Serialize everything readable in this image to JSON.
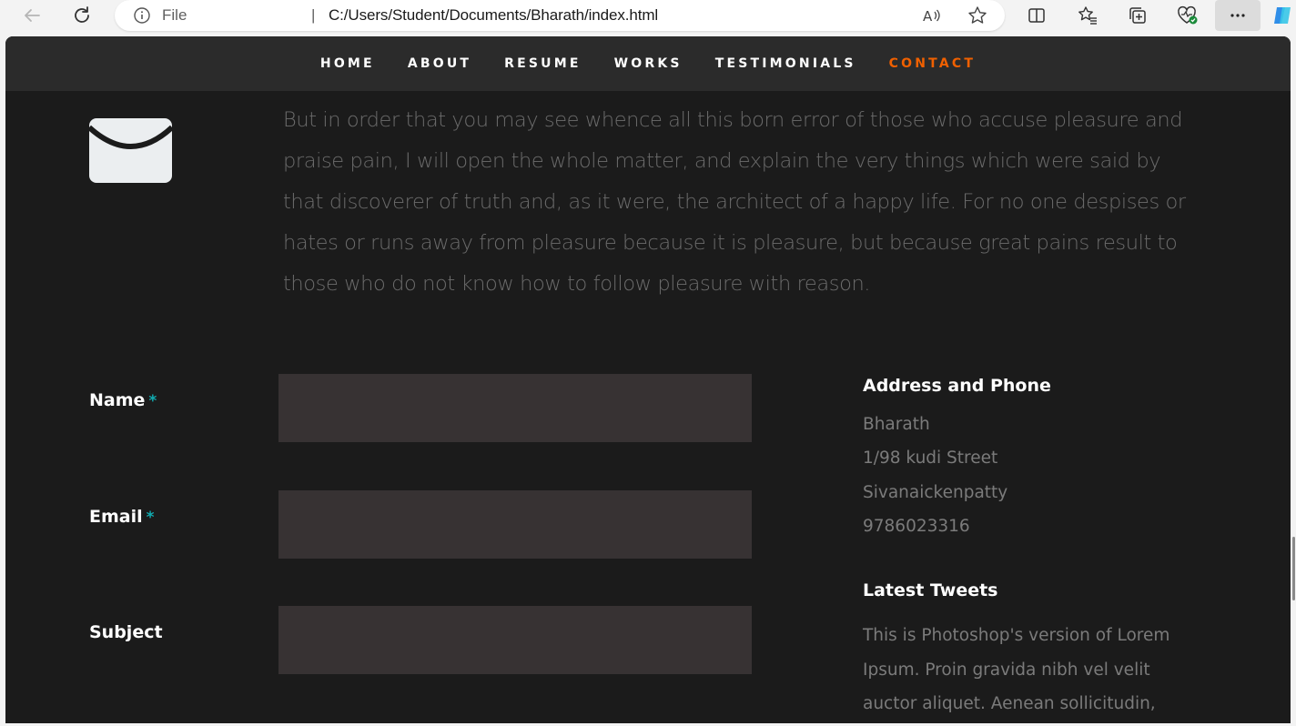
{
  "browser": {
    "file_label": "File",
    "separator": "|",
    "url": "C:/Users/Student/Documents/Bharath/index.html"
  },
  "nav": {
    "items": [
      "HOME",
      "ABOUT",
      "RESUME",
      "WORKS",
      "TESTIMONIALS",
      "CONTACT"
    ],
    "active": "CONTACT"
  },
  "intro": "But in order that you may see whence all this born error of those who accuse pleasure and praise pain, I will open the whole matter, and explain the very things which were said by that discoverer of truth and, as it were, the architect of a happy life. For no one despises or hates or runs away from pleasure because it is pleasure, but because great pains result to those who do not know how to follow pleasure with reason.",
  "form": {
    "name_label": "Name",
    "email_label": "Email",
    "subject_label": "Subject",
    "required_mark": "*",
    "name_value": "",
    "email_value": "",
    "subject_value": ""
  },
  "aside": {
    "address_title": "Address and Phone",
    "address_lines": [
      "Bharath",
      "1/98 kudi Street",
      "Sivanaickenpatty",
      "9786023316"
    ],
    "tweets_title": "Latest Tweets",
    "tweet_text": "This is Photoshop's version of Lorem Ipsum. Proin gravida nibh vel velit auctor aliquet. Aenean sollicitudin, lorem quis"
  },
  "colors": {
    "accent": "#f06000",
    "required": "#11abb0",
    "background": "#1b1b1b",
    "input_bg": "#373233"
  }
}
